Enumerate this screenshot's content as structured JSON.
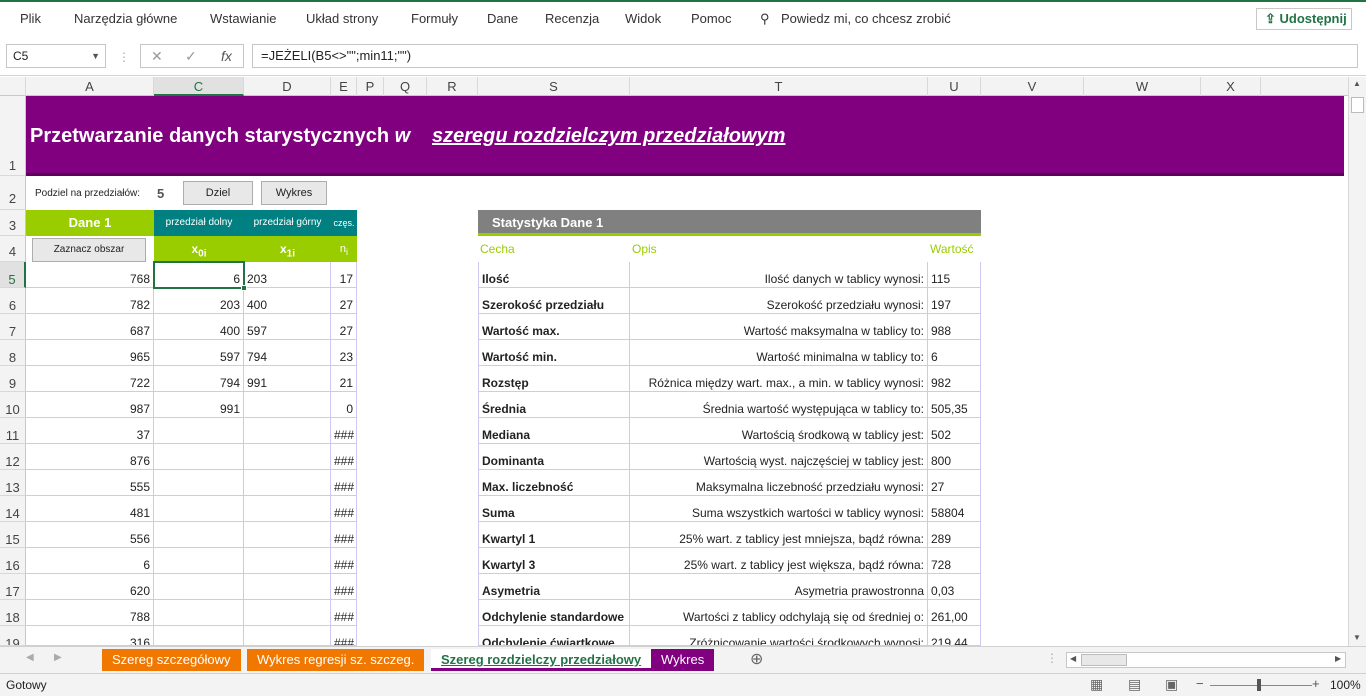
{
  "ribbon": {
    "tabs": [
      "Plik",
      "Narzędzia główne",
      "Wstawianie",
      "Układ strony",
      "Formuły",
      "Dane",
      "Recenzja",
      "Widok",
      "Pomoc"
    ],
    "tell_me": "Powiedz mi, co chcesz zrobić",
    "share": "Udostępnij"
  },
  "formula_bar": {
    "name_box": "C5",
    "formula": "=JEŻELI(B5<>\"\";min11;\"\")"
  },
  "columns": [
    "A",
    "C",
    "D",
    "E",
    "P",
    "Q",
    "R",
    "S",
    "T",
    "U",
    "V",
    "W",
    "X"
  ],
  "selected_column": "C",
  "rows": [
    "1",
    "2",
    "3",
    "4",
    "5",
    "6",
    "7",
    "8",
    "9",
    "10",
    "11",
    "12",
    "13",
    "14",
    "15",
    "16",
    "17",
    "18",
    "19"
  ],
  "selected_row": "5",
  "title": {
    "main": "Przetwarzanie danych starystycznych",
    "w": "w",
    "sub": "szeregu rozdzielczym przedziałowym"
  },
  "controls": {
    "divide_label": "Podziel na przedziałów:",
    "divide_value": "5",
    "btn_split": "Dziel",
    "btn_chart": "Wykres",
    "btn_mark": "Zaznacz obszar"
  },
  "left_table": {
    "header_a": "Dane 1",
    "header_c": "przedział dolny",
    "header_d": "przedział górny",
    "header_e": "częs.",
    "sub_c_main": "x",
    "sub_c_idx": "0i",
    "sub_d_main": "x",
    "sub_d_idx": "1i",
    "sub_e_main": "n",
    "sub_e_idx": "i",
    "rows": [
      [
        "768",
        "6",
        "203",
        "17"
      ],
      [
        "782",
        "203",
        "400",
        "27"
      ],
      [
        "687",
        "400",
        "597",
        "27"
      ],
      [
        "965",
        "597",
        "794",
        "23"
      ],
      [
        "722",
        "794",
        "991",
        "21"
      ],
      [
        "987",
        "991",
        "",
        "0"
      ],
      [
        "37",
        "",
        "",
        "###"
      ],
      [
        "876",
        "",
        "",
        "###"
      ],
      [
        "555",
        "",
        "",
        "###"
      ],
      [
        "481",
        "",
        "",
        "###"
      ],
      [
        "556",
        "",
        "",
        "###"
      ],
      [
        "6",
        "",
        "",
        "###"
      ],
      [
        "620",
        "",
        "",
        "###"
      ],
      [
        "788",
        "",
        "",
        "###"
      ],
      [
        "316",
        "",
        "",
        "###"
      ]
    ]
  },
  "stats": {
    "title": "Statystyka Dane 1",
    "col_feature": "Cecha",
    "col_desc": "Opis",
    "col_value": "Wartość",
    "rows": [
      {
        "feature": "Ilość",
        "desc": "Ilość danych w tablicy wynosi:",
        "value": "115"
      },
      {
        "feature": "Szerokość przedziału",
        "desc": "Szerokość przedziału wynosi:",
        "value": "197"
      },
      {
        "feature": "Wartość max.",
        "desc": "Wartość maksymalna w tablicy to:",
        "value": "988"
      },
      {
        "feature": "Wartość min.",
        "desc": "Wartość minimalna w tablicy to:",
        "value": "6"
      },
      {
        "feature": "Rozstęp",
        "desc": "Różnica między wart. max., a min. w tablicy wynosi:",
        "value": "982"
      },
      {
        "feature": "Średnia",
        "desc": "Średnia wartość występująca w tablicy to:",
        "value": "505,35"
      },
      {
        "feature": "Mediana",
        "desc": "Wartością środkową w tablicy jest:",
        "value": "502"
      },
      {
        "feature": "Dominanta",
        "desc": "Wartością wyst. najczęściej w tablicy jest:",
        "value": "800"
      },
      {
        "feature": "Max. liczebność",
        "desc": "Maksymalna liczebność przedziału wynosi:",
        "value": "27"
      },
      {
        "feature": "Suma",
        "desc": "Suma wszystkich wartości w tablicy wynosi:",
        "value": "58804"
      },
      {
        "feature": "Kwartyl 1",
        "desc": "25% wart. z tablicy jest mniejsza, bądź równa:",
        "value": "289"
      },
      {
        "feature": "Kwartyl 3",
        "desc": "25% wart. z tablicy jest większa, bądź równa:",
        "value": "728"
      },
      {
        "feature": "Asymetria",
        "desc": "Asymetria prawostronna",
        "value": "0,03"
      },
      {
        "feature": "Odchylenie standardowe",
        "desc": "Wartości z tablicy odchylają się od średniej o:",
        "value": "261,00"
      },
      {
        "feature": "Odchylenie ćwiartkowe",
        "desc": "Zróżnicowanie wartości środkowych wynosi:",
        "value": "219,44"
      }
    ]
  },
  "sheet_tabs": [
    {
      "label": "Szereg szczegółowy",
      "color": "#f07800"
    },
    {
      "label": "Wykres regresji sz. szczeg.",
      "color": "#f07800"
    },
    {
      "label": "Szereg rozdzielczy przedziałowy",
      "color": "#800080",
      "active": true
    },
    {
      "label": "Wykres",
      "color": "#800080"
    }
  ],
  "status": {
    "ready": "Gotowy",
    "zoom": "100%"
  },
  "colors": {
    "title_bg": "#800080",
    "green": "#9acd00",
    "teal": "#008080",
    "stats_header": "#808080",
    "excel_green": "#217346"
  }
}
